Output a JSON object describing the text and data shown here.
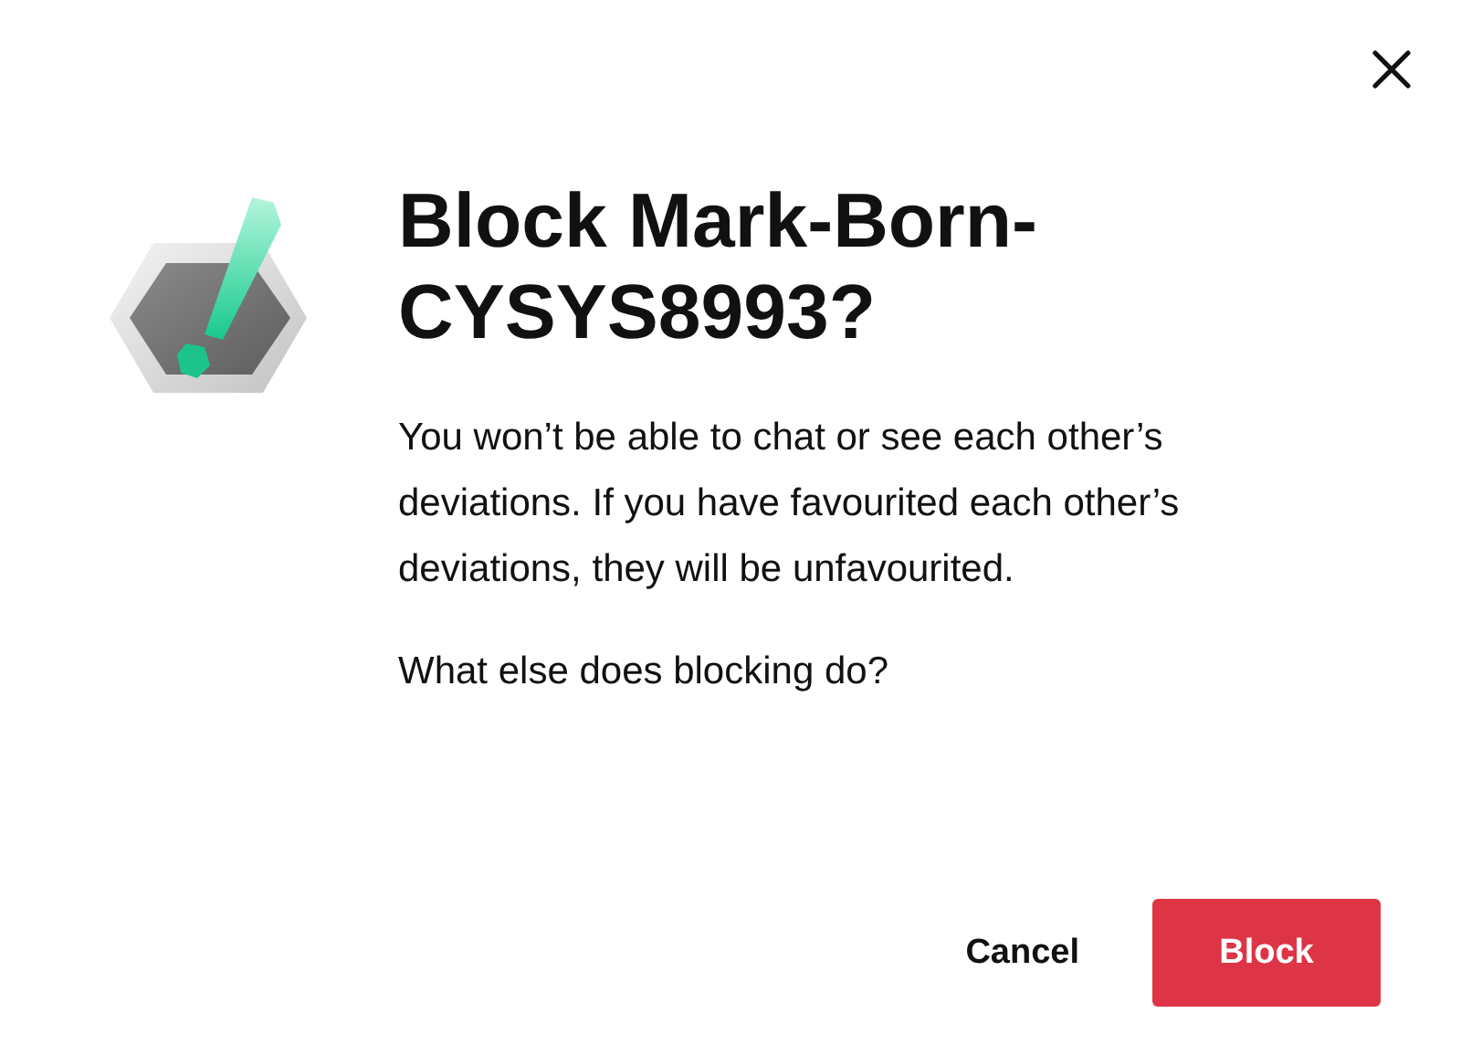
{
  "dialog": {
    "title": "Block Mark-Born-CYSYS8993?",
    "message": "You won’t be able to chat or see each other’s deviations. If you have favourited each other’s deviations, they will be unfavourited.",
    "help_link": "What else does blocking do?",
    "buttons": [
      {
        "label": "Cancel",
        "kind": "secondary"
      },
      {
        "label": "Block",
        "kind": "primary"
      }
    ]
  }
}
